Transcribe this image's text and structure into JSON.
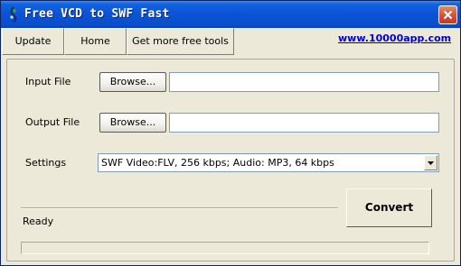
{
  "window": {
    "title": "Free VCD to SWF Fast"
  },
  "toolbar": {
    "update_label": "Update",
    "home_label": "Home",
    "free_tools_label": "Get more free tools"
  },
  "website_link": "www.10000app.com",
  "form": {
    "input_label": "Input File",
    "output_label": "Output File",
    "settings_label": "Settings",
    "browse_label": "Browse...",
    "input_value": "",
    "output_value": "",
    "settings_value": "SWF Video:FLV, 256 kbps; Audio: MP3, 64 kbps"
  },
  "convert_label": "Convert",
  "status_text": "Ready",
  "progress": 0,
  "icons": {
    "app": "app-icon",
    "close": "close-icon",
    "dropdown": "chevron-down-icon"
  },
  "colors": {
    "titlebar": "#0a53d4",
    "link": "#0000cc",
    "close": "#d4553a"
  }
}
